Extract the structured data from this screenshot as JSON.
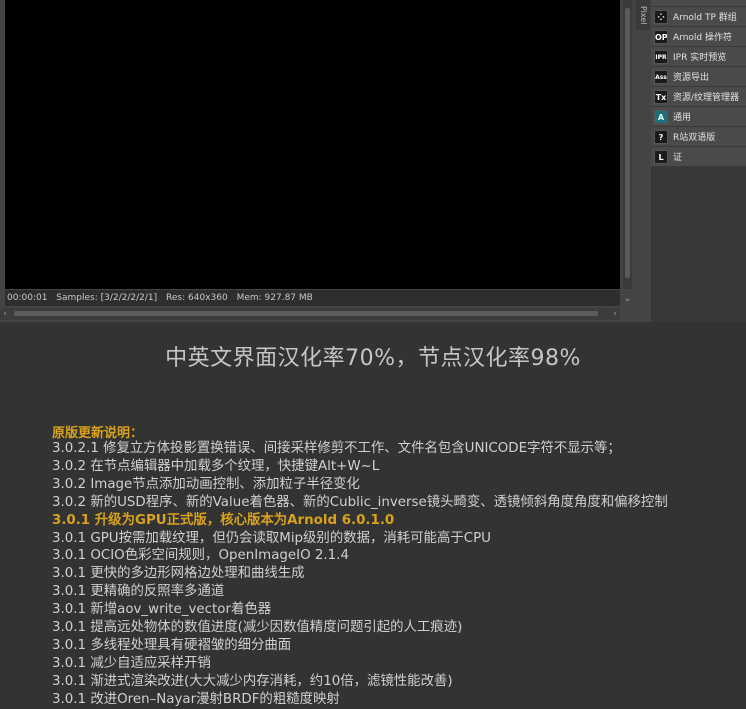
{
  "statusbar": {
    "time": "00:00:01",
    "samples": "Samples: [3/2/2/2/2/1]",
    "res": "Res: 640x360",
    "mem": "Mem: 927.87 MB"
  },
  "side_tab_label": "Pixel",
  "menu": [
    {
      "icon": "",
      "label": ""
    },
    {
      "icon": "⁘",
      "label": "Arnold TP 群组"
    },
    {
      "icon": "OP",
      "label": "Arnold 操作符"
    },
    {
      "icon": "IPR",
      "label": "IPR 实时预览"
    },
    {
      "icon": "Ass",
      "label": "资源导出"
    },
    {
      "icon": "Tx",
      "label": "资源/纹理管理器"
    },
    {
      "icon": "A",
      "label": "通用"
    },
    {
      "icon": "?",
      "label": "R站双语版"
    },
    {
      "icon": "L",
      "label": "证"
    }
  ],
  "headline": "中英文界面汉化率70%，节点汉化率98%",
  "notes_title": "原版更新说明：",
  "notes": [
    "3.0.2.1 修复立方体投影置换错误、间接采样修剪不工作、文件名包含UNICODE字符不显示等；",
    "3.0.2 在节点编辑器中加载多个纹理，快捷键Alt+W~L",
    "3.0.2 Image节点添加动画控制、添加粒子半径变化",
    "3.0.2 新的USD程序、新的Value着色器、新的Cublic_inverse镜头畸变、透镜倾斜角度角度和偏移控制",
    "3.0.1 升级为GPU正式版，核心版本为Arnold 6.0.1.0",
    "3.0.1 GPU按需加载纹理，但仍会读取Mip级别的数据，消耗可能高于CPU",
    "3.0.1 OCIO色彩空间规则，OpenImageIO 2.1.4",
    "3.0.1 更快的多边形网格边处理和曲线生成",
    "3.0.1 更精确的反照率多通道",
    "3.0.1 新增aov_write_vector着色器",
    "3.0.1 提高远处物体的数值进度(减少因数值精度问题引起的人工痕迹)",
    "3.0.1 多线程处理具有硬褶皱的细分曲面",
    "3.0.1 减少自适应采样开销",
    "3.0.1 渐进式渲染改进(大大减少内存消耗，约10倍，滤镜性能改善)",
    "3.0.1 改进Oren–Nayar漫射BRDF的粗糙度映射"
  ],
  "highlight_index": 4,
  "colors": {
    "accent": "#d8a21c",
    "body_text": "#d0d0d0",
    "background": "#333333"
  }
}
